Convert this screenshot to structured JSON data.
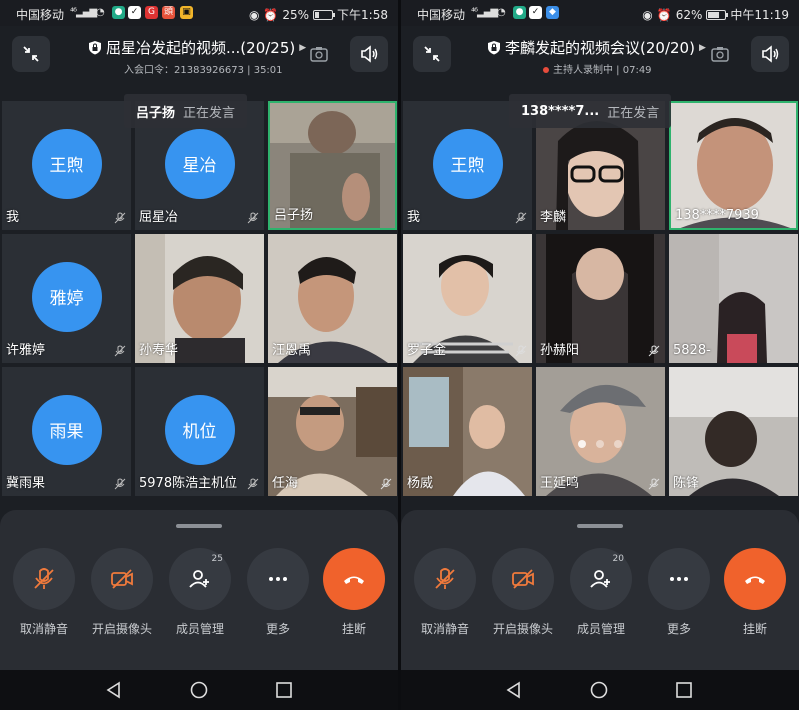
{
  "colors": {
    "accent_blue": "#3794f0",
    "hangup_orange": "#f0622c",
    "active_green": "#2fb36d",
    "icon_orange": "#f07a3c",
    "record_red": "#e74c3c"
  },
  "left": {
    "status": {
      "carrier": "中国移动",
      "network": "⁴⁶ᵢₗₗ",
      "battery": "25%",
      "time": "下午1:58"
    },
    "header": {
      "title": "屈星冶发起的视频...(20/25)",
      "subtitle": "入会口令：21383926673 | 35:01"
    },
    "speaker": {
      "name": "吕子扬",
      "status": "正在发言"
    },
    "tiles": [
      {
        "name": "我",
        "avatar": "王煦",
        "type": "avatar",
        "muted": true
      },
      {
        "name": "屈星冶",
        "avatar": "星冶",
        "type": "avatar",
        "muted": true
      },
      {
        "name": "吕子扬",
        "avatar": "",
        "type": "video",
        "muted": false,
        "active": true
      },
      {
        "name": "许雅婷",
        "avatar": "雅婷",
        "type": "avatar",
        "muted": true
      },
      {
        "name": "孙寿华",
        "avatar": "",
        "type": "video",
        "muted": false
      },
      {
        "name": "汪恩禹",
        "avatar": "",
        "type": "video",
        "muted": false
      },
      {
        "name": "冀雨果",
        "avatar": "雨果",
        "type": "avatar",
        "muted": true
      },
      {
        "name": "5978陈浩主机位",
        "avatar": "机位",
        "type": "avatar",
        "muted": true
      },
      {
        "name": "任海",
        "avatar": "",
        "type": "video",
        "muted": true
      }
    ],
    "controls": [
      {
        "icon": "mic-muted-icon",
        "label": "取消静音"
      },
      {
        "icon": "camera-off-icon",
        "label": "开启摄像头"
      },
      {
        "icon": "member-add-icon",
        "label": "成员管理",
        "count": "25"
      },
      {
        "icon": "more-icon",
        "label": "更多"
      },
      {
        "icon": "hangup-icon",
        "label": "挂断"
      }
    ]
  },
  "right": {
    "status": {
      "carrier": "中国移动",
      "network": "⁴⁶ᵢₗₗ",
      "battery": "62%",
      "time": "中午11:19"
    },
    "header": {
      "title": "李麟发起的视频会议(20/20)",
      "subtitle": "主持人录制中 | 07:49"
    },
    "speaker": {
      "name": "138****7...",
      "status": "正在发言"
    },
    "tiles": [
      {
        "name": "我",
        "avatar": "王煦",
        "type": "avatar",
        "muted": true
      },
      {
        "name": "李麟",
        "avatar": "",
        "type": "video",
        "muted": false
      },
      {
        "name": "138****7939",
        "avatar": "",
        "type": "video",
        "muted": false,
        "active": true
      },
      {
        "name": "罗子金",
        "avatar": "",
        "type": "video",
        "muted": true
      },
      {
        "name": "孙赫阳",
        "avatar": "",
        "type": "video",
        "muted": true
      },
      {
        "name": "5828-",
        "avatar": "",
        "type": "video",
        "muted": false
      },
      {
        "name": "杨威",
        "avatar": "",
        "type": "video",
        "muted": false
      },
      {
        "name": "王延鸣",
        "avatar": "",
        "type": "video",
        "muted": true
      },
      {
        "name": "陈锋",
        "avatar": "",
        "type": "video",
        "muted": false
      }
    ],
    "controls": [
      {
        "icon": "mic-muted-icon",
        "label": "取消静音"
      },
      {
        "icon": "camera-off-icon",
        "label": "开启摄像头"
      },
      {
        "icon": "member-add-icon",
        "label": "成员管理",
        "count": "20"
      },
      {
        "icon": "more-icon",
        "label": "更多"
      },
      {
        "icon": "hangup-icon",
        "label": "挂断"
      }
    ]
  }
}
